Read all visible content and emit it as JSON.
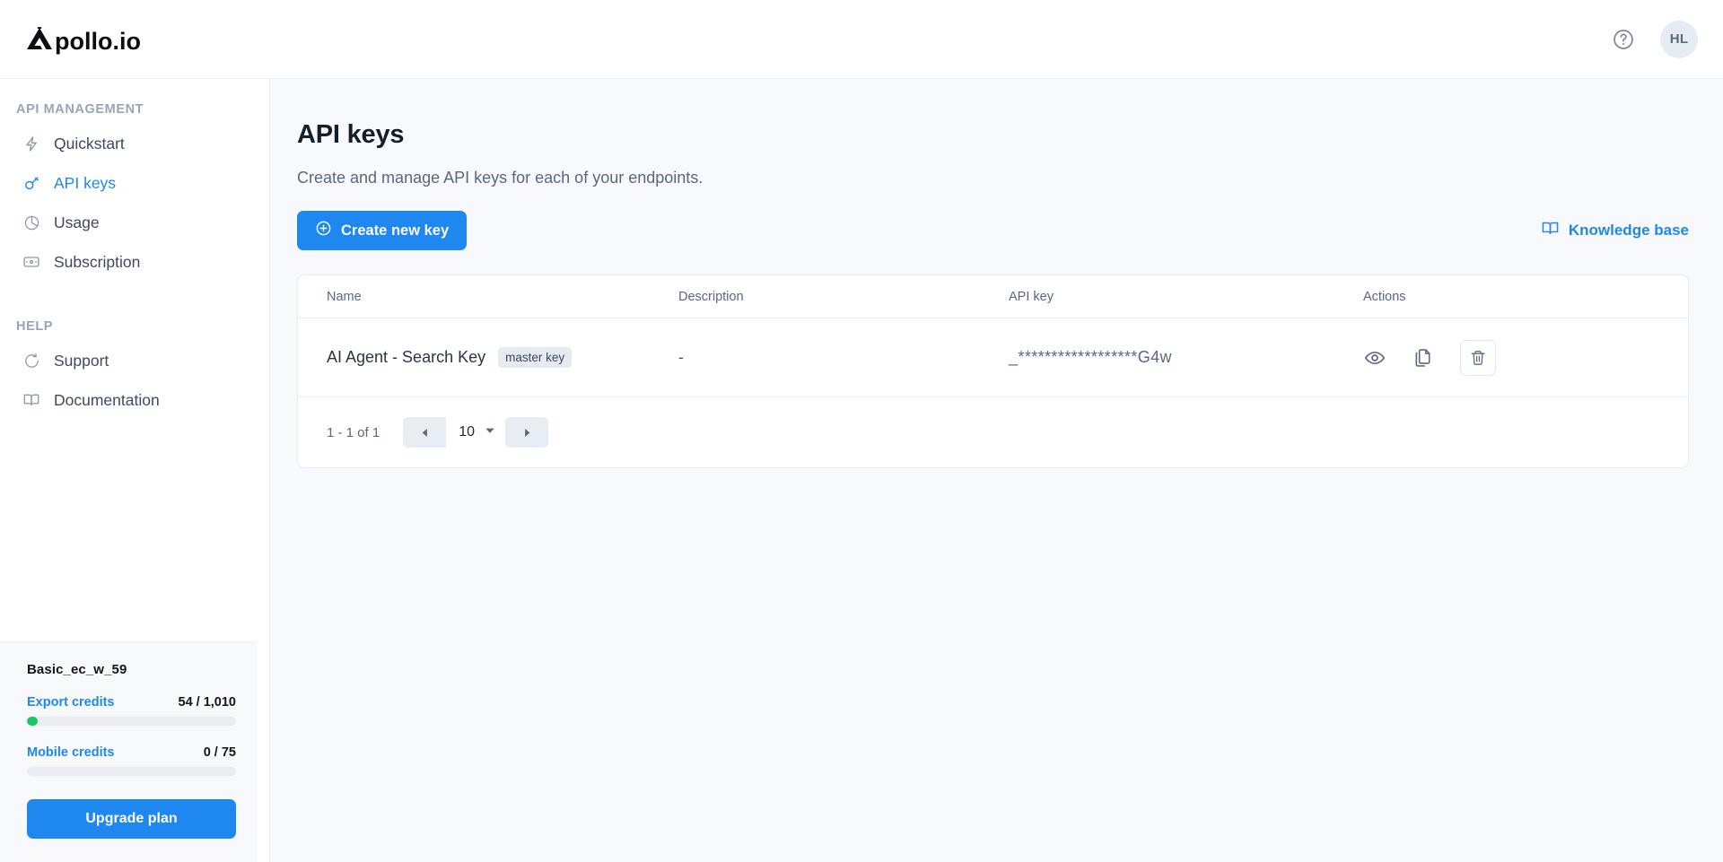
{
  "header": {
    "logo_text": "Apollo.io",
    "help_icon": "question-circle-icon",
    "avatar_initials": "HL"
  },
  "sidebar": {
    "sections": [
      {
        "title": "API MANAGEMENT",
        "items": [
          {
            "label": "Quickstart",
            "icon": "lightning-bolt-icon",
            "active": false
          },
          {
            "label": "API keys",
            "icon": "key-icon",
            "active": true
          },
          {
            "label": "Usage",
            "icon": "pie-chart-icon",
            "active": false
          },
          {
            "label": "Subscription",
            "icon": "credit-card-icon",
            "active": false
          }
        ]
      },
      {
        "title": "HELP",
        "items": [
          {
            "label": "Support",
            "icon": "lifebuoy-icon",
            "active": false
          },
          {
            "label": "Documentation",
            "icon": "book-icon",
            "active": false
          }
        ]
      }
    ],
    "plan_card": {
      "plan_name": "Basic_ec_w_59",
      "credits": [
        {
          "label": "Export credits",
          "value": "54 / 1,010",
          "percent": 5.3,
          "fill_color": "#17c964"
        },
        {
          "label": "Mobile credits",
          "value": "0 / 75",
          "percent": 0,
          "fill_color": "#17c964"
        }
      ],
      "upgrade_label": "Upgrade plan"
    }
  },
  "main": {
    "title": "API keys",
    "description": "Create and manage API keys for each of your endpoints.",
    "create_button": "Create new key",
    "knowledge_base_link": "Knowledge base",
    "table": {
      "columns": [
        "Name",
        "Description",
        "API key",
        "Actions"
      ],
      "rows": [
        {
          "name": "AI Agent - Search Key",
          "badge": "master key",
          "description": "-",
          "api_key": "_******************G4w",
          "actions": [
            "eye-icon",
            "copy-icon",
            "trash-icon"
          ]
        }
      ]
    },
    "pagination": {
      "range_text": "1 - 1 of 1",
      "page_size": "10",
      "prev_icon": "triangle-left-icon",
      "next_icon": "triangle-right-icon"
    }
  },
  "colors": {
    "accent": "#1e87f0",
    "success": "#17c964",
    "main_bg": "#f7f9fc",
    "text": "#2b3445"
  }
}
